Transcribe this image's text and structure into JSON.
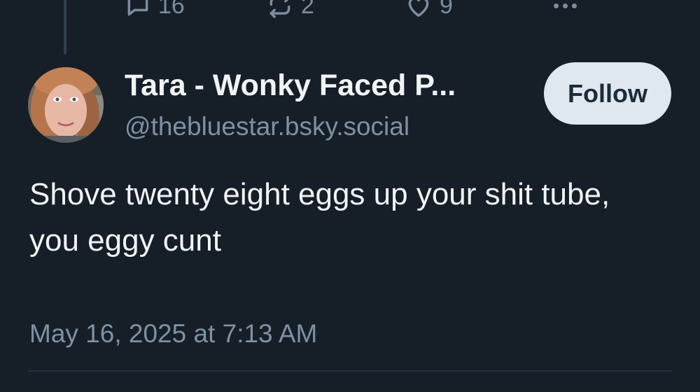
{
  "parent_post": {
    "actions": {
      "reply_count": "16",
      "repost_count": "2",
      "like_count": "9"
    }
  },
  "post": {
    "author": {
      "display_name": "Tara - Wonky Faced P...",
      "handle": "@thebluestar.bsky.social"
    },
    "follow_label": "Follow",
    "text": "Shove twenty eight eggs up your shit tube, you eggy cunt",
    "timestamp": "May 16, 2025 at 7:13 AM"
  },
  "icons": {
    "reply": "reply-bubble-icon",
    "repost": "repost-arrows-icon",
    "like": "heart-icon",
    "more": "more-options-icon"
  },
  "colors": {
    "background": "#161e27",
    "text_primary": "#f1f3f5",
    "text_secondary": "#7e91a4",
    "follow_button_bg": "#dfe7ef",
    "follow_button_text": "#1c2b3a"
  }
}
